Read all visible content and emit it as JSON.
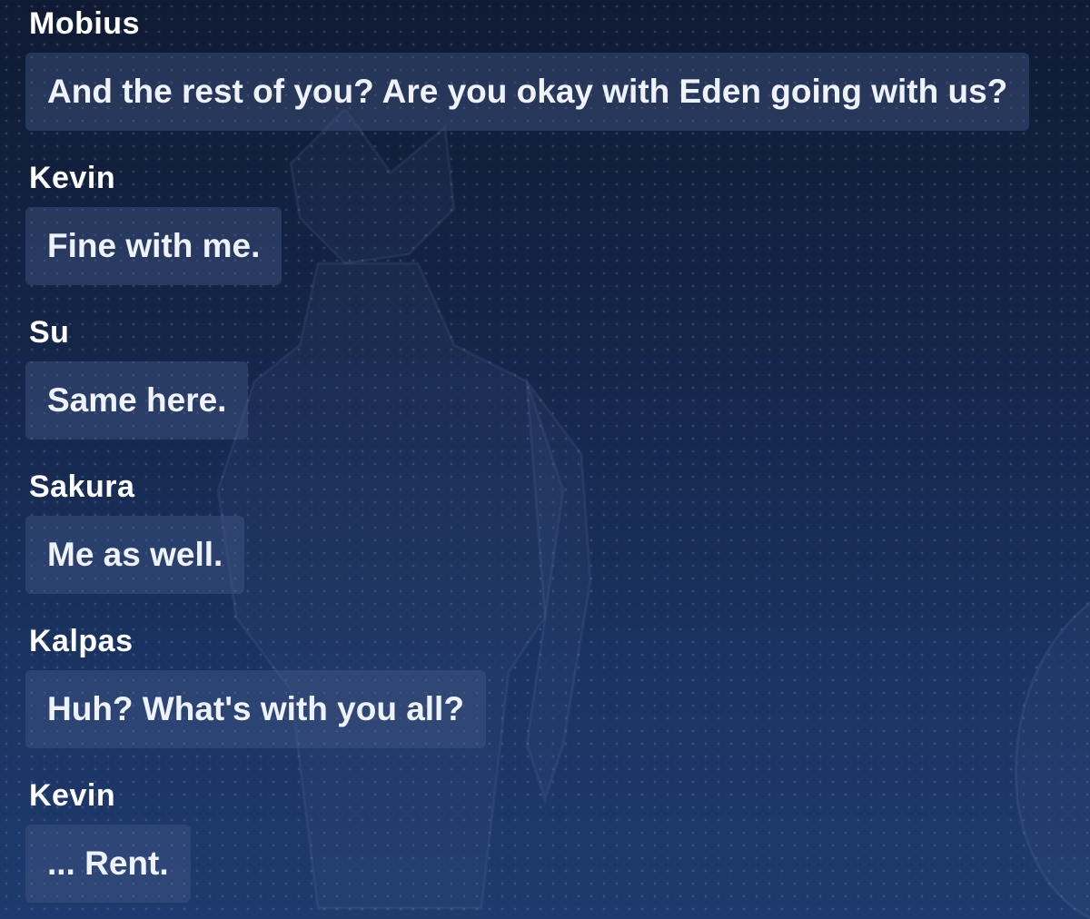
{
  "dialogue": [
    {
      "speaker": "Mobius",
      "text": "And the rest of you? Are you okay with Eden going with us?"
    },
    {
      "speaker": "Kevin",
      "text": "Fine with me."
    },
    {
      "speaker": "Su",
      "text": "Same here."
    },
    {
      "speaker": "Sakura",
      "text": "Me as well."
    },
    {
      "speaker": "Kalpas",
      "text": "Huh? What's with you all?"
    },
    {
      "speaker": "Kevin",
      "text": "... Rent."
    }
  ],
  "colors": {
    "background_top": "#0f1b33",
    "background_bottom": "#1e3a6e",
    "bubble": "#465a87",
    "text": "#ffffff"
  }
}
